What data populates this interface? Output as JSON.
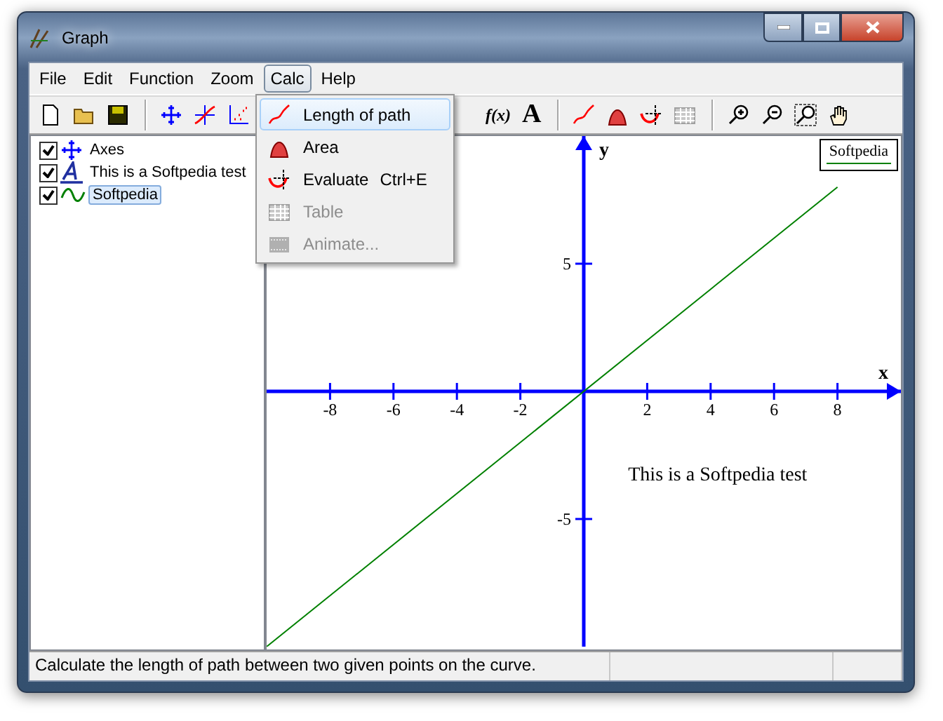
{
  "window": {
    "title": "Graph"
  },
  "menu_bar": [
    {
      "label": "File",
      "selected": false
    },
    {
      "label": "Edit",
      "selected": false
    },
    {
      "label": "Function",
      "selected": false
    },
    {
      "label": "Zoom",
      "selected": false
    },
    {
      "label": "Calc",
      "selected": true
    },
    {
      "label": "Help",
      "selected": false
    }
  ],
  "toolbar": [
    {
      "kind": "new"
    },
    {
      "kind": "open"
    },
    {
      "kind": "save"
    },
    {
      "kind": "separator"
    },
    {
      "kind": "axes"
    },
    {
      "kind": "function"
    },
    {
      "kind": "points"
    },
    {
      "kind": "hidden"
    },
    {
      "kind": "text",
      "label": "f(x)"
    },
    {
      "kind": "text",
      "label": "A"
    },
    {
      "kind": "separator"
    },
    {
      "kind": "path"
    },
    {
      "kind": "area"
    },
    {
      "kind": "evaluate"
    },
    {
      "kind": "table"
    },
    {
      "kind": "separator"
    },
    {
      "kind": "zoom-in"
    },
    {
      "kind": "zoom-out"
    },
    {
      "kind": "zoom-square"
    },
    {
      "kind": "hand"
    }
  ],
  "function_list": [
    {
      "label": "Axes",
      "kind": "axes",
      "checked": true,
      "selected": false
    },
    {
      "label": "This is a Softpedia test",
      "kind": "label",
      "checked": true,
      "selected": false
    },
    {
      "label": "Softpedia",
      "kind": "function",
      "checked": true,
      "selected": true
    }
  ],
  "calc_menu": [
    {
      "label": "Length of path",
      "kind": "path",
      "selected": true,
      "disabled": false
    },
    {
      "label": "Area",
      "kind": "area",
      "selected": false,
      "disabled": false
    },
    {
      "label": "Evaluate",
      "kind": "evaluate",
      "shortcut": "Ctrl+E",
      "selected": false,
      "disabled": false
    },
    {
      "label": "Table",
      "kind": "table",
      "selected": false,
      "disabled": true
    },
    {
      "label": "Animate...",
      "kind": "animate",
      "selected": false,
      "disabled": true
    }
  ],
  "graph": {
    "chart_data": {
      "type": "line",
      "xlabel": "x",
      "ylabel": "y",
      "xlim": [
        -10,
        10
      ],
      "ylim": [
        -10,
        10
      ],
      "xticks": [
        -8,
        -6,
        -4,
        -2,
        2,
        4,
        6,
        8
      ],
      "yticks": [
        -5,
        5
      ],
      "x": [
        -10,
        8
      ],
      "series": [
        {
          "name": "Softpedia",
          "color": "#008000",
          "values": [
            -10,
            8
          ]
        }
      ],
      "annotations": [
        "This is a Softpedia test"
      ]
    }
  },
  "status_bar": "Calculate the length of path between two given points on the curve."
}
